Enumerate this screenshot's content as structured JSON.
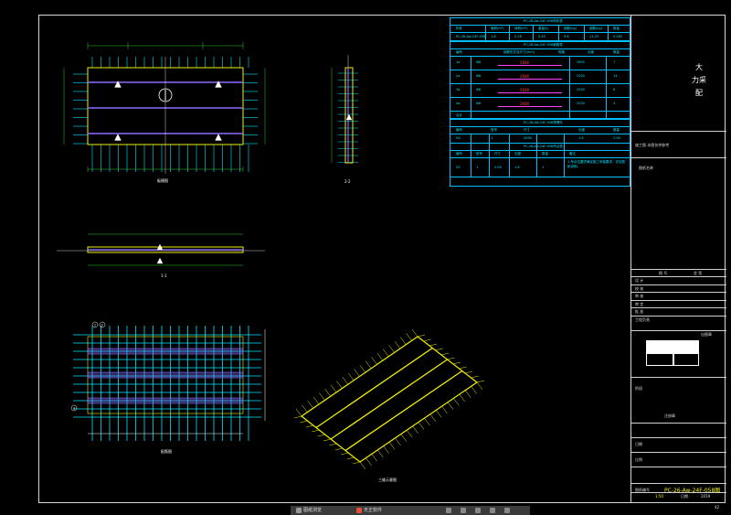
{
  "title_block": {
    "company_line1": "大",
    "company_line2": "力采",
    "company_line3": "配",
    "project_note": "施工图 本图仅供参考",
    "sheet_title": "图纸名称",
    "rows": [
      "图 号",
      "设 计",
      "校 核",
      "审 核",
      "审 定",
      "批 准",
      "工程负责"
    ],
    "right_col": "会 签",
    "stamp_caption": "出图章",
    "stage_label": "阶段",
    "reg_label": "注册章",
    "date_label": "日期",
    "scale_label": "比例",
    "drawing_no_label": "图纸编号",
    "drawing_no": "PC-26-Aw-24F-058图",
    "bottom_left": "1:50",
    "bottom_mid": "日期",
    "bottom_right": "2019",
    "sheet_number": "42"
  },
  "table1": {
    "title": "PC-26-Aw-24F-058构件表",
    "headers": [
      "构件",
      "面积(m²)",
      "体积(m³)",
      "重量(t)",
      "钢筋(kg)",
      "钢筋(kg)",
      "数量"
    ],
    "row": [
      "PC-26-Aw-24F-058",
      "1.8",
      "0.18",
      "0.45",
      "9.8",
      "11.25",
      "0.265"
    ]
  },
  "table2": {
    "title": "PC-26-Aw-24F-058钢筋表",
    "headers": [
      "编号",
      "钢筋形式及尺寸(mm)",
      "规格",
      "长度",
      "数量"
    ],
    "rows": [
      {
        "id": "1a",
        "spec": "Φ8",
        "dim": "2680",
        "len": "2852",
        "qty": "7"
      },
      {
        "id": "2a",
        "spec": "Φ8",
        "dim": "2680",
        "len": "2020",
        "qty": "14"
      },
      {
        "id": "3a",
        "spec": "Φ8",
        "dim": "2680",
        "len": "2020",
        "qty": "8"
      },
      {
        "id": "4a",
        "spec": "Φ8",
        "dim": "2680",
        "len": "2020",
        "qty": "4"
      }
    ],
    "total": "合计"
  },
  "table3": {
    "title": "PC-26-Aw-24F-058预埋件",
    "headers": [
      "编号",
      "型号",
      "尺寸",
      "长度",
      "数量"
    ],
    "row1": [
      "SA",
      "1",
      "2000",
      "1.6",
      "2.00"
    ],
    "title2": "PC-26-Aw-24F-058吊点表",
    "headers2": [
      "编号",
      "型号",
      "尺寸",
      "长度",
      "数量",
      "备注"
    ],
    "row2": [
      "SZ",
      "1",
      "2.00",
      "1.6",
      "1"
    ],
    "note": "1.吊点位置须满足施工吊装要求，详见图纸说明。"
  },
  "views": {
    "plan": "板模图",
    "section_22": "2-2",
    "section_11": "1-1",
    "rebar": "配筋图",
    "iso": "三维示意图"
  },
  "taskbar": {
    "items": [
      "图纸浏览",
      "天正软件"
    ]
  },
  "colors": {
    "rebar_cyan": "#00e5ff",
    "panel_yellow": "#f2f000",
    "rebar_purple": "#8c6cff",
    "dim_green": "#2ec82e",
    "table_blue": "#00bfff"
  }
}
